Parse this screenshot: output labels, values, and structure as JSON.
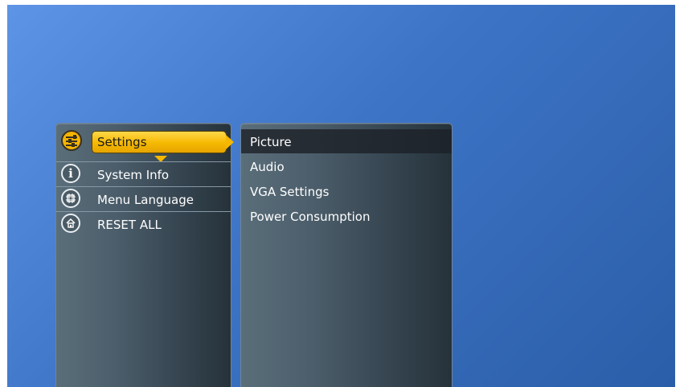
{
  "main_menu": {
    "items": [
      {
        "label": "Settings",
        "icon": "settings-sliders-icon",
        "selected": true
      },
      {
        "label": "System Info",
        "icon": "info-icon",
        "selected": false
      },
      {
        "label": "Menu Language",
        "icon": "language-icon",
        "selected": false
      },
      {
        "label": "RESET ALL",
        "icon": "home-reset-icon",
        "selected": false
      }
    ]
  },
  "sub_menu": {
    "items": [
      {
        "label": "Picture",
        "selected": true
      },
      {
        "label": "Audio",
        "selected": false
      },
      {
        "label": "VGA Settings",
        "selected": false
      },
      {
        "label": "Power Consumption",
        "selected": false
      }
    ]
  },
  "colors": {
    "background": "#3d74c6",
    "highlight": "#f5b800",
    "panel": "#4b5d6a",
    "text": "#ffffff"
  }
}
